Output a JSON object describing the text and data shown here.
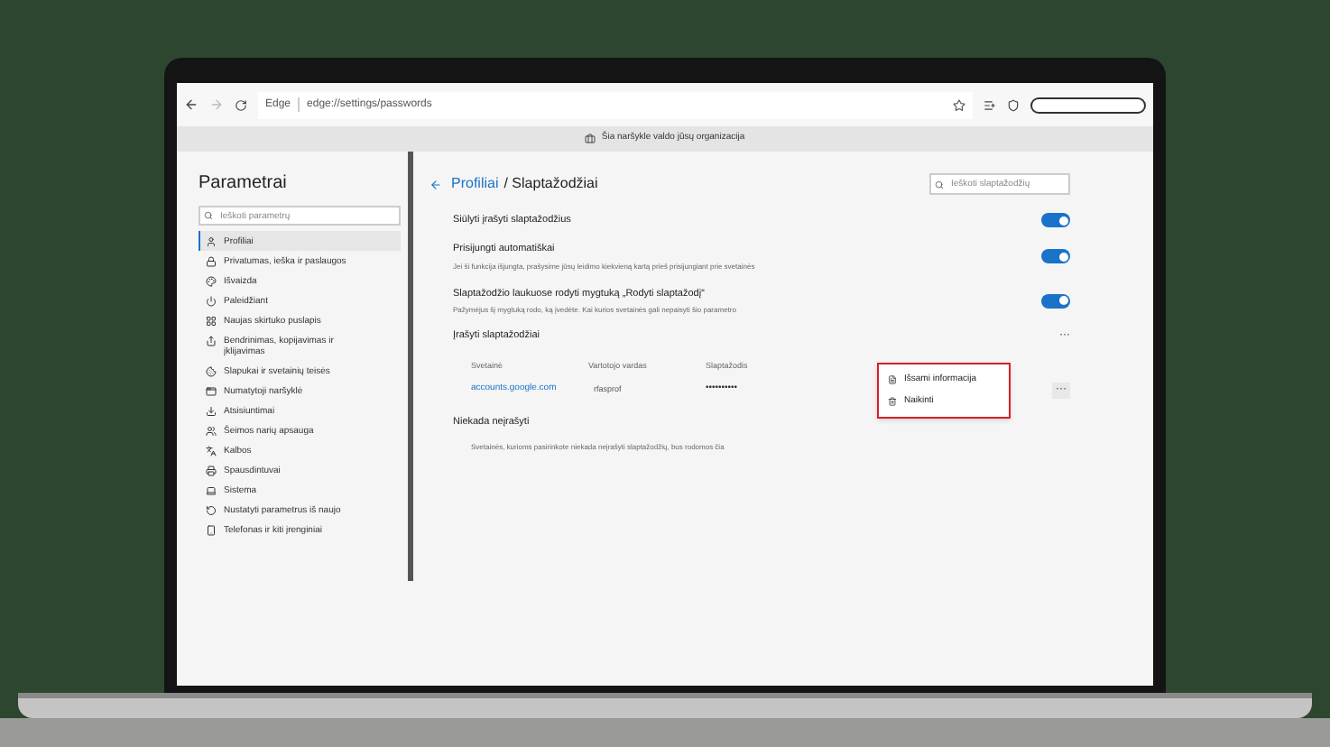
{
  "browser": {
    "brand": "Edge",
    "url": "edge://settings/passwords",
    "managed_notice": "Šia naršykle valdo jūsų organizacija"
  },
  "sidebar": {
    "title": "Parametrai",
    "search": {
      "placeholder": "Ieškoti parametrų"
    },
    "items": [
      {
        "label": "Profiliai",
        "selected": true
      },
      {
        "label": "Privatumas, ieška ir paslaugos",
        "selected": false
      },
      {
        "label": "Išvaizda",
        "selected": false
      },
      {
        "label": "Paleidžiant",
        "selected": false
      },
      {
        "label": "Naujas skirtuko puslapis",
        "selected": false
      },
      {
        "label": "Bendrinimas, kopijavimas ir įklijavimas",
        "selected": false
      },
      {
        "label": "Slapukai ir svetainių teisės",
        "selected": false
      },
      {
        "label": "Numatytoji naršyklė",
        "selected": false
      },
      {
        "label": "Atsisiuntimai",
        "selected": false
      },
      {
        "label": "Šeimos narių apsauga",
        "selected": false
      },
      {
        "label": "Kalbos",
        "selected": false
      },
      {
        "label": "Spausdintuvai",
        "selected": false
      },
      {
        "label": "Sistema",
        "selected": false
      },
      {
        "label": "Nustatyti parametrus iš naujo",
        "selected": false
      },
      {
        "label": "Telefonas ir kiti įrenginiai",
        "selected": false
      }
    ]
  },
  "main": {
    "breadcrumb_parent": "Profiliai",
    "breadcrumb_current": "/ Slaptažodžiai",
    "search": {
      "placeholder": "Ieškoti slaptažodžių"
    },
    "settings": [
      {
        "label": "Siūlyti įrašyti slaptažodžius",
        "on": true
      },
      {
        "label": "Prisijungti automatiškai",
        "description": "Jei ši funkcija išjungta, prašysime jūsų leidimo kiekvieną kartą prieš prisijungiant prie svetainės",
        "on": true
      },
      {
        "label": "Slaptažodžio laukuose rodyti mygtuką „Rodyti slaptažodį“",
        "description": "Pažymėjus šį mygtuką rodo, ką įvedėte. Kai kurios svetainės gali nepaisyti šio parametro",
        "on": true
      }
    ],
    "saved": {
      "title": "Įrašyti slaptažodžiai",
      "more": "···",
      "columns": [
        "Svetainė",
        "Vartotojo vardas",
        "Slaptažodis"
      ],
      "rows": [
        {
          "site": "accounts.google.com",
          "username": "rfasprof",
          "password": "••••••••••",
          "more": "···"
        }
      ]
    },
    "menu": {
      "items": [
        "Išsami informacija",
        "Naikinti"
      ]
    },
    "never": {
      "title": "Niekada neįrašyti",
      "description": "Svetainės, kurioms pasirinkote niekada neįrašyti slaptažodžių, bus rodomos čia"
    }
  }
}
